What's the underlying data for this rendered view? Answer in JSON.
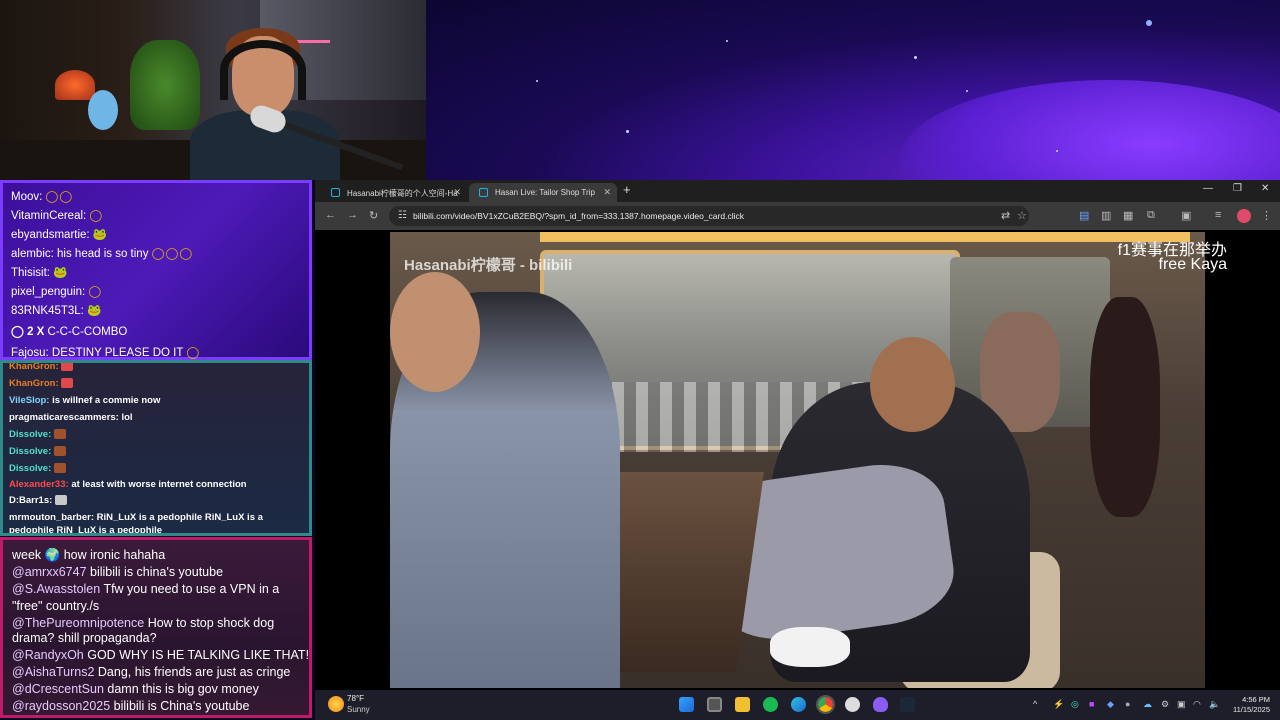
{
  "chat_top": [
    {
      "user": "Moov:",
      "msg": "",
      "emote": "◯◯"
    },
    {
      "user": "VitaminCereal:",
      "msg": "",
      "emote": "◯"
    },
    {
      "user": "ebyandsmartie:",
      "msg": "",
      "emote": "🐸"
    },
    {
      "user": "alembic:",
      "msg": "his head is so tiny",
      "emote": "◯◯◯"
    },
    {
      "user": "Thisisit:",
      "msg": "",
      "emote": "🐸"
    },
    {
      "user": "pixel_penguin:",
      "msg": "",
      "emote": "◯"
    },
    {
      "user": "83RNK45T3L:",
      "msg": "",
      "emote": "🐸"
    },
    {
      "user": "◯ 2 X",
      "msg": "C-C-C-COMBO",
      "emote": ""
    },
    {
      "user": "Fajosu:",
      "msg": "DESTINY PLEASE DO IT",
      "emote": "◯"
    }
  ],
  "chat_mid": [
    {
      "user": "KhanGron:",
      "msg": "",
      "color": "#e67e22"
    },
    {
      "user": "KhanGron:",
      "msg": "",
      "color": "#e67e22"
    },
    {
      "user": "VileSlop:",
      "msg": "is willnef a commie now",
      "color": "#7fd4ff"
    },
    {
      "user": "pragmaticarescammers:",
      "msg": "lol",
      "color": "#ffffff"
    },
    {
      "user": "Dissolve:",
      "msg": "",
      "color": "#4de0c8"
    },
    {
      "user": "Dissolve:",
      "msg": "",
      "color": "#4de0c8"
    },
    {
      "user": "Dissolve:",
      "msg": "",
      "color": "#4de0c8"
    },
    {
      "user": "Alexander33:",
      "msg": "at least with worse internet connection",
      "color": "#ff4a4a"
    },
    {
      "user": "D:Barr1s:",
      "msg": "",
      "color": "#ffffff"
    },
    {
      "user": "mrmouton_barber:",
      "msg": "RiN_LuX is a pedophile RiN_LuX is a",
      "color": "#ffffff"
    },
    {
      "user": "pedophile RiN_LuX is a pedophile",
      "msg": "",
      "color": "#ffffff"
    }
  ],
  "chat_bottom": [
    {
      "handle": "",
      "msg": "week 🌍 how ironic hahaha"
    },
    {
      "handle": "@amrxx6747",
      "msg": "bilibili is china's youtube"
    },
    {
      "handle": "@S.Awasstolen",
      "msg": "Tfw you need to use a VPN in a"
    },
    {
      "handle": "",
      "msg": "\"free\" country./s"
    },
    {
      "handle": "@ThePureomnipotence",
      "msg": "How to stop shock dog"
    },
    {
      "handle": "",
      "msg": "drama? shill propaganda?"
    },
    {
      "handle": "@RandyxOh",
      "msg": "GOD WHY IS HE TALKING LIKE THAT!"
    },
    {
      "handle": "@AishaTurns2",
      "msg": "Dang, his friends are just as cringe"
    },
    {
      "handle": "@dCrescentSun",
      "msg": "damn this is big gov money"
    },
    {
      "handle": "@raydosson2025",
      "msg": "bilibili is China's youtube"
    }
  ],
  "browser": {
    "tabs": [
      {
        "label": "Hasanabi柠檬哥的个人空间-Ha",
        "active": false
      },
      {
        "label": "Hasan Live: Tailor Shop Trip",
        "active": true
      }
    ],
    "url": "bilibili.com/video/BV1xZCuB2EBQ/?spm_id_from=333.1387.homepage.video_card.click",
    "watermark": "Hasanabi柠檬哥 - bilibili",
    "overlay_line1": "f1赛事在那举办",
    "overlay_line2": "free Kaya"
  },
  "taskbar": {
    "weather_temp": "78°F",
    "weather_desc": "Sunny",
    "time": "4:56 PM",
    "date": "11/15/2025"
  },
  "colors": {
    "accent_purple": "#7b3cff",
    "accent_teal": "#2f8a8a",
    "accent_pink": "#c01a6a"
  }
}
